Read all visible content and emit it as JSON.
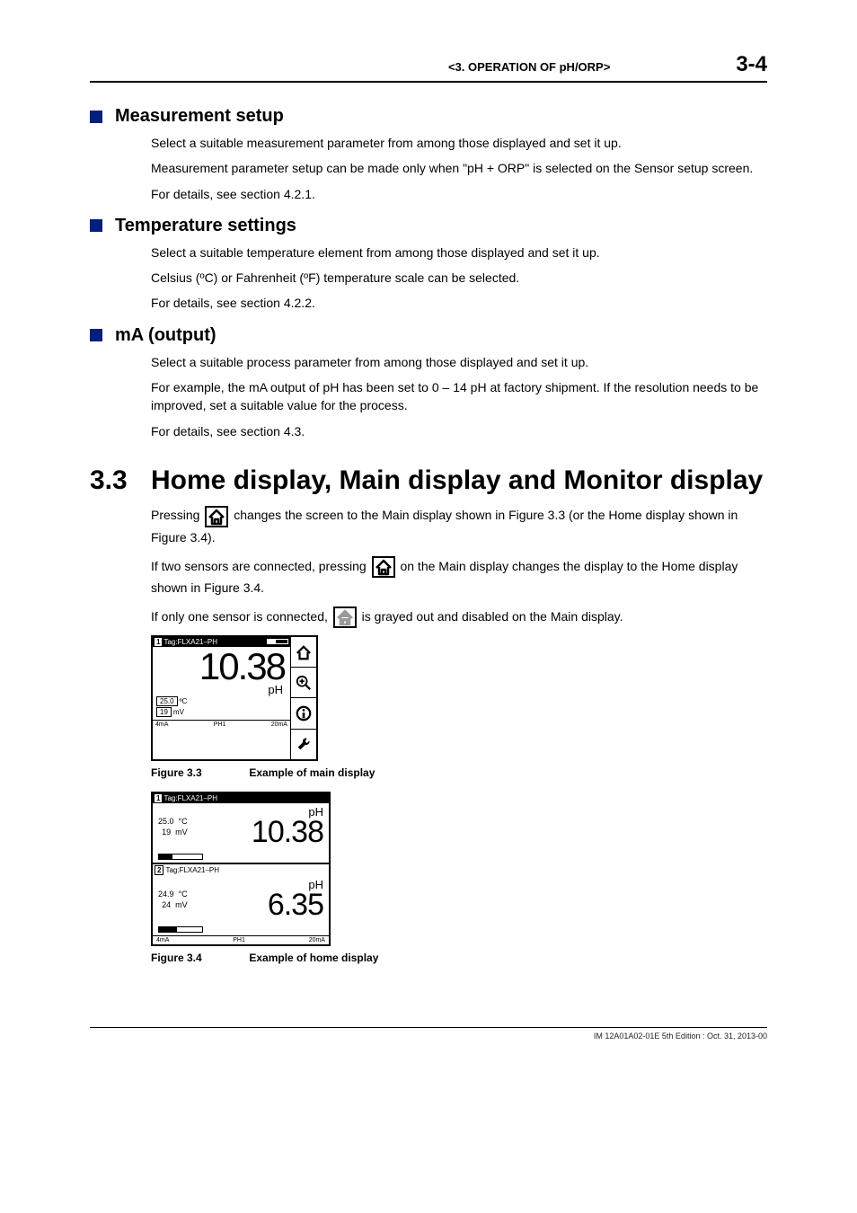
{
  "header": {
    "section": "<3.  OPERATION OF pH/ORP>",
    "page": "3-4"
  },
  "h1": {
    "title": "Measurement setup",
    "p1": "Select a suitable measurement parameter from among those displayed and set it up.",
    "p2": "Measurement parameter setup can be made only when \"pH + ORP\" is selected on the Sensor setup screen.",
    "p3": "For details, see section 4.2.1."
  },
  "h2": {
    "title": "Temperature settings",
    "p1": "Select a suitable temperature element from among those displayed and set it up.",
    "p2": "Celsius (ºC) or Fahrenheit (ºF) temperature scale can be selected.",
    "p3": "For details, see section 4.2.2."
  },
  "h3": {
    "title": "mA (output)",
    "p1": "Select a suitable process parameter from among those displayed and set it up.",
    "p2": "For example, the mA output of pH has been set to 0 – 14 pH at factory shipment. If the resolution needs to be improved, set a suitable value for the process.",
    "p3": "For details, see section 4.3."
  },
  "sec33": {
    "num": "3.3",
    "title": "Home display, Main display and Monitor display",
    "p1a": "Pressing ",
    "p1b": " changes the screen to the Main display shown in Figure 3.3 (or the Home display shown in Figure 3.4).",
    "p2a": "If two sensors are connected, pressing ",
    "p2b": " on the Main display changes the display to the Home display shown in Figure 3.4.",
    "p3a": "If only one sensor is connected, ",
    "p3b": " is grayed out and disabled on the Main display."
  },
  "fig33": {
    "tag_num": "1",
    "tag": "Tag:FLXA21–PH",
    "main_val": "10.38",
    "unit": "pH",
    "sub1_val": "25.0",
    "sub1_unit": "ºC",
    "sub2_val": "19",
    "sub2_unit": "mV",
    "bottom_l": "4mA",
    "bottom_c": "PH1",
    "bottom_r": "20mA",
    "cap_label": "Figure 3.3",
    "cap_text": "Example of main display"
  },
  "fig34": {
    "s1": {
      "num": "1",
      "tag": "Tag:FLXA21–PH",
      "t": "25.0",
      "t_unit": "°C",
      "mv": "19",
      "mv_unit": "mV",
      "unit": "pH",
      "val": "10.38"
    },
    "s2": {
      "num": "2",
      "tag": "Tag:FLXA21–PH",
      "t": "24.9",
      "t_unit": "°C",
      "mv": "24",
      "mv_unit": "mV",
      "unit": "pH",
      "val": "6.35"
    },
    "bottom_l": "4mA",
    "bottom_c": "PH1",
    "bottom_r": "20mA",
    "cap_label": "Figure 3.4",
    "cap_text": "Example of home display"
  },
  "footer": "IM 12A01A02-01E     5th Edition : Oct. 31, 2013-00"
}
